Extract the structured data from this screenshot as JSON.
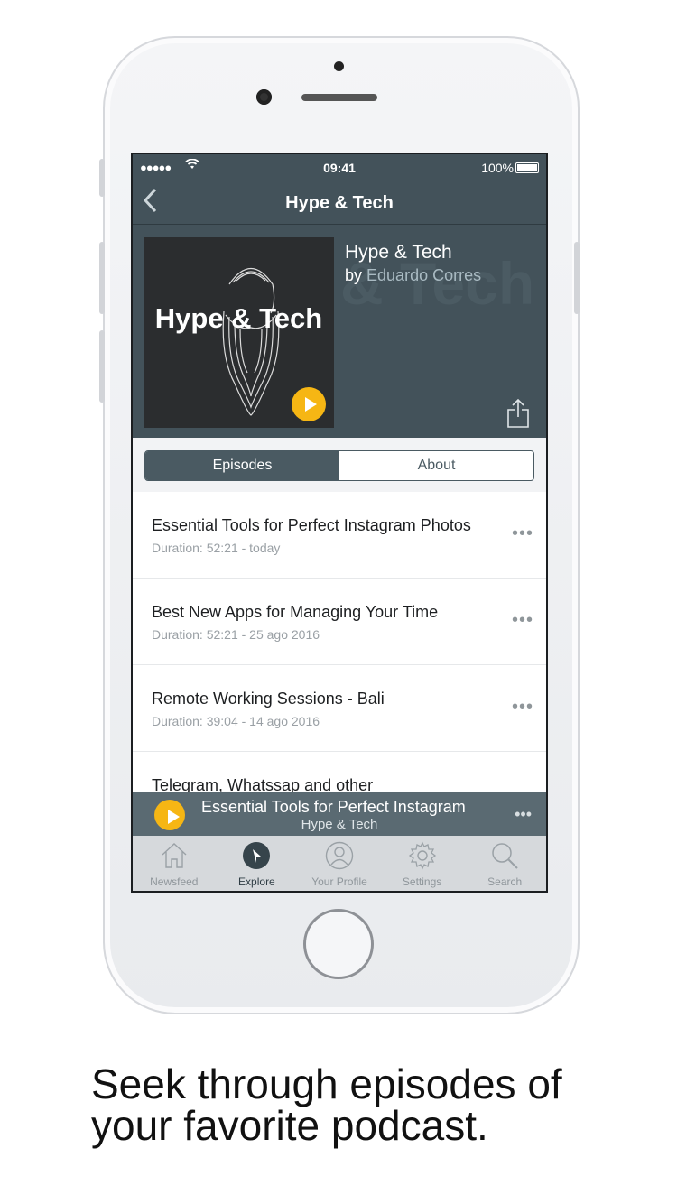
{
  "status_bar": {
    "signal": "●●●●●",
    "time": "09:41",
    "battery": "100%"
  },
  "nav": {
    "title": "Hype & Tech",
    "back_icon": "chevron-left-icon"
  },
  "podcast": {
    "cover_title": "Hype & Tech",
    "background_text": "& Tech",
    "title": "Hype & Tech",
    "by_label": "by",
    "author": "Eduardo Corres"
  },
  "segments": {
    "episodes": "Episodes",
    "about": "About",
    "selected": "Episodes"
  },
  "episodes": [
    {
      "title": "Essential Tools for Perfect Instagram Photos",
      "meta": "Duration: 52:21 - today"
    },
    {
      "title": "Best New Apps for Managing Your Time",
      "meta": "Duration: 52:21 - 25 ago 2016"
    },
    {
      "title": "Remote Working Sessions - Bali",
      "meta": "Duration: 39:04 - 14 ago 2016"
    },
    {
      "title": "Telegram, Whatssap and other",
      "meta": ""
    }
  ],
  "mini_player": {
    "title": "Essential Tools for Perfect Instagram",
    "subtitle": "Hype & Tech"
  },
  "tabs": [
    {
      "label": "Newsfeed",
      "icon": "house-icon"
    },
    {
      "label": "Explore",
      "icon": "compass-icon"
    },
    {
      "label": "Your Profile",
      "icon": "user-icon"
    },
    {
      "label": "Settings",
      "icon": "gear-icon"
    },
    {
      "label": "Search",
      "icon": "search-icon"
    }
  ],
  "active_tab": "Explore",
  "caption": {
    "line1": "Seek through episodes of",
    "line2": "your favorite podcast."
  },
  "colors": {
    "header": "#43525a",
    "accent": "#f6b614",
    "author": "#a9bac2",
    "tabbar": "#d6d9dc"
  }
}
